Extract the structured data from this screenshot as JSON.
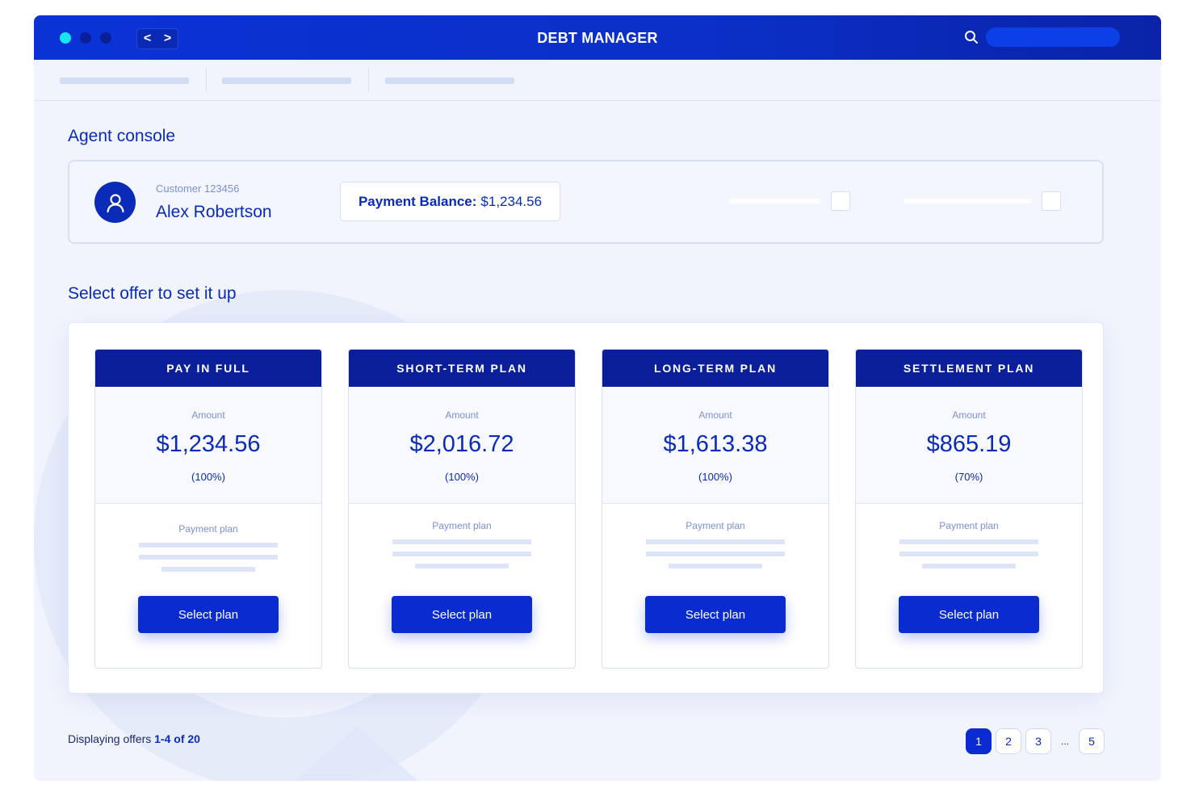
{
  "window": {
    "title": "DEBT MANAGER",
    "nav_back": "<",
    "nav_forward": ">"
  },
  "console": {
    "heading": "Agent console",
    "customer": {
      "id_label": "Customer 123456",
      "name": "Alex Robertson"
    },
    "balance": {
      "label": "Payment Balance:",
      "value": "$1,234.56"
    }
  },
  "offers": {
    "heading": "Select offer to set it up",
    "plans": [
      {
        "title": "PAY IN FULL",
        "amount_label": "Amount",
        "amount": "$1,234.56",
        "percent": "(100%)",
        "payment_plan_label": "Payment plan",
        "button": "Select plan"
      },
      {
        "title": "SHORT-TERM PLAN",
        "amount_label": "Amount",
        "amount": "$2,016.72",
        "percent": "(100%)",
        "payment_plan_label": "Payment plan",
        "button": "Select plan"
      },
      {
        "title": "LONG-TERM PLAN",
        "amount_label": "Amount",
        "amount": "$1,613.38",
        "percent": "(100%)",
        "payment_plan_label": "Payment plan",
        "button": "Select plan"
      },
      {
        "title": "SETTLEMENT PLAN",
        "amount_label": "Amount",
        "amount": "$865.19",
        "percent": "(70%)",
        "payment_plan_label": "Payment plan",
        "button": "Select plan"
      }
    ]
  },
  "footer": {
    "display_prefix": "Displaying offers",
    "display_range": "1-4 of 20",
    "pages": [
      "1",
      "2",
      "3",
      "5"
    ],
    "ellipsis": "...",
    "current_page": "1"
  },
  "colors": {
    "brand_blue": "#0a2bd0",
    "header_navy": "#0a1f99",
    "accent_cyan": "#18e3f0",
    "page_background": "#f1f4fd"
  },
  "icons": {
    "avatar": "user-icon",
    "search": "search-icon"
  }
}
